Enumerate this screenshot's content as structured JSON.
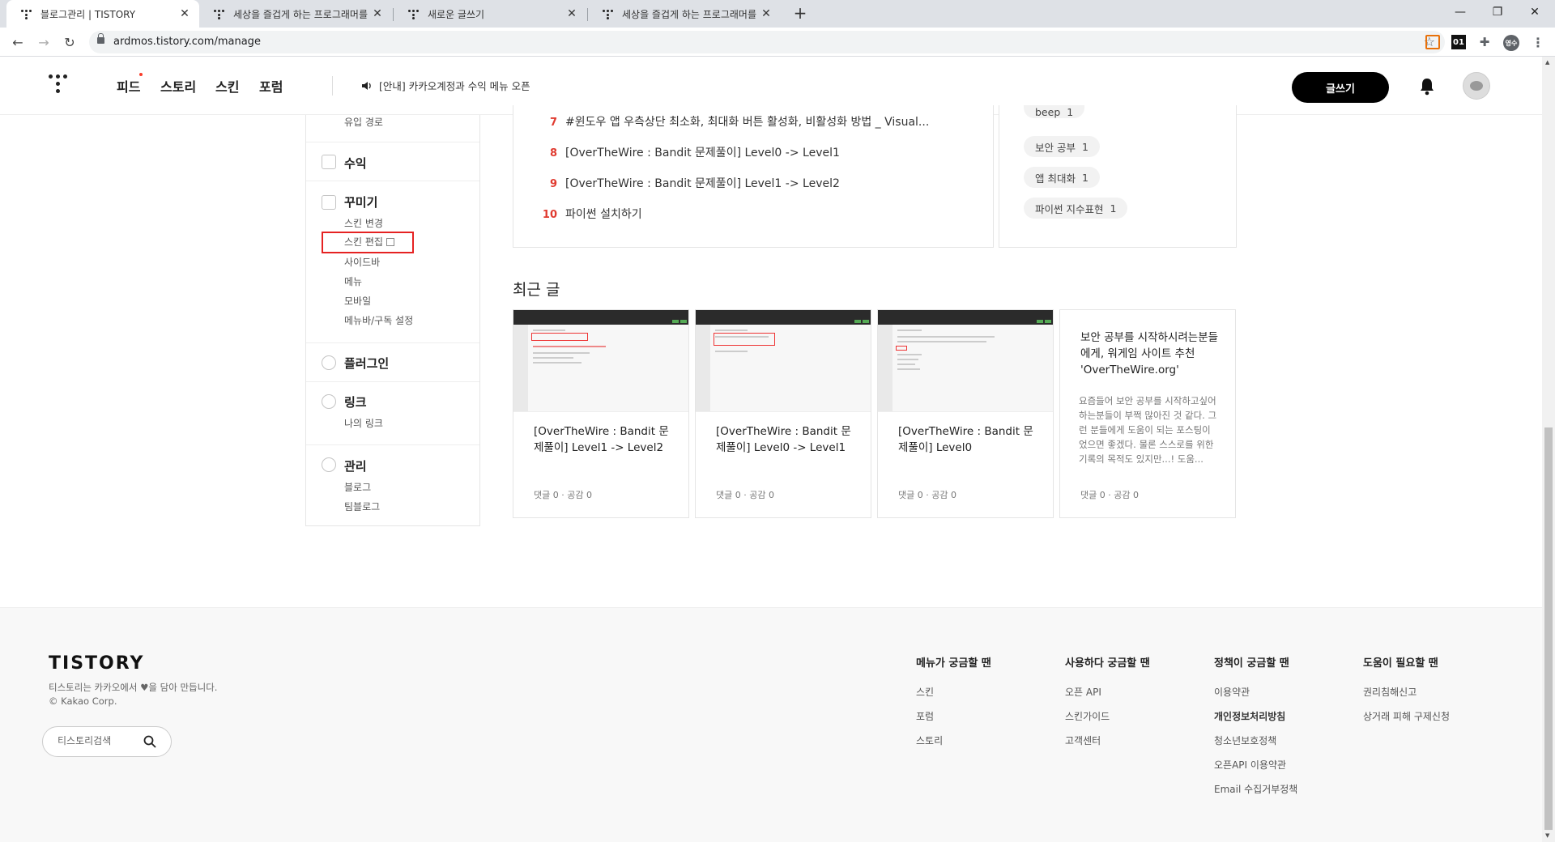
{
  "browser": {
    "tabs": [
      {
        "title": "블로그관리 | TISTORY",
        "active": true
      },
      {
        "title": "세상을 즐겁게 하는 프로그래머를",
        "active": false
      },
      {
        "title": "새로운 글쓰기",
        "active": false
      },
      {
        "title": "세상을 즐겁게 하는 프로그래머를",
        "active": false
      }
    ],
    "url": "ardmos.tistory.com/manage",
    "ext_label": "01",
    "profile_label": "영수"
  },
  "header": {
    "nav": [
      "피드",
      "스토리",
      "스킨",
      "포럼"
    ],
    "notice": "[안내] 카카오계정과 수익 메뉴 오픈",
    "write_label": "글쓰기"
  },
  "sidebar": {
    "top_sub": "유입 경로",
    "groups": [
      {
        "title": "수익",
        "items": []
      },
      {
        "title": "꾸미기",
        "items": [
          "스킨 변경",
          "스킨 편집",
          "사이드바",
          "메뉴",
          "모바일",
          "메뉴바/구독 설정"
        ]
      },
      {
        "title": "플러그인",
        "items": []
      },
      {
        "title": "링크",
        "items": [
          "나의 링크"
        ]
      },
      {
        "title": "관리",
        "items": [
          "블로그",
          "팀블로그"
        ]
      }
    ]
  },
  "popular_posts": [
    {
      "rank": "7",
      "title": "#윈도우 앱 우측상단 최소화, 최대화 버튼 활성화, 비활성화 방법 _ Visual..."
    },
    {
      "rank": "8",
      "title": "[OverTheWire : Bandit 문제풀이] Level0 -> Level1"
    },
    {
      "rank": "9",
      "title": "[OverTheWire : Bandit 문제풀이] Level1 -> Level2"
    },
    {
      "rank": "10",
      "title": "파이썬 설치하기"
    }
  ],
  "tags": [
    {
      "name": "beep",
      "count": "1"
    },
    {
      "name": "보안 공부",
      "count": "1"
    },
    {
      "name": "앱 최대화",
      "count": "1"
    },
    {
      "name": "파이썬 지수표현",
      "count": "1"
    }
  ],
  "recent": {
    "title": "최근 글",
    "cards": [
      {
        "title": "[OverTheWire : Bandit 문제풀이] Level1 -> Level2",
        "meta": "댓글 0 · 공감 0"
      },
      {
        "title": "[OverTheWire : Bandit 문제풀이] Level0 -> Level1",
        "meta": "댓글 0 · 공감 0"
      },
      {
        "title": "[OverTheWire : Bandit 문제풀이] Level0",
        "meta": "댓글 0 · 공감 0"
      },
      {
        "title": "보안 공부를 시작하시려는분들에게, 워게임 사이트 추천 'OverTheWire.org'",
        "desc": "요즘들어 보안 공부를 시작하고싶어하는분들이 부쩍 많아진 것 같다. 그런 분들에게 도움이 되는 포스팅이었으면 좋겠다. 물론 스스로를 위한 기록의 목적도 있지만...! 도움...",
        "meta": "댓글 0 · 공감 0"
      }
    ]
  },
  "footer": {
    "logo": "TISTORY",
    "tagline": "티스토리는 카카오에서 ♥을 담아 만듭니다.",
    "copyright": "© Kakao Corp.",
    "search_placeholder": "티스토리검색",
    "columns": [
      {
        "title": "메뉴가 궁금할 땐",
        "links": [
          "스킨",
          "포럼",
          "스토리"
        ]
      },
      {
        "title": "사용하다 궁금할 땐",
        "links": [
          "오픈 API",
          "스킨가이드",
          "고객센터"
        ]
      },
      {
        "title": "정책이 궁금할 땐",
        "links": [
          "이용약관",
          "개인정보처리방침",
          "청소년보호정책",
          "오픈API 이용약관",
          "Email 수집거부정책"
        ]
      },
      {
        "title": "도움이 필요할 땐",
        "links": [
          "권리침해신고",
          "상거래 피해 구제신청"
        ]
      }
    ]
  },
  "colors": {
    "accent": "#e03a2f",
    "highlight_box": "#e52222",
    "write_button": "#000000"
  }
}
